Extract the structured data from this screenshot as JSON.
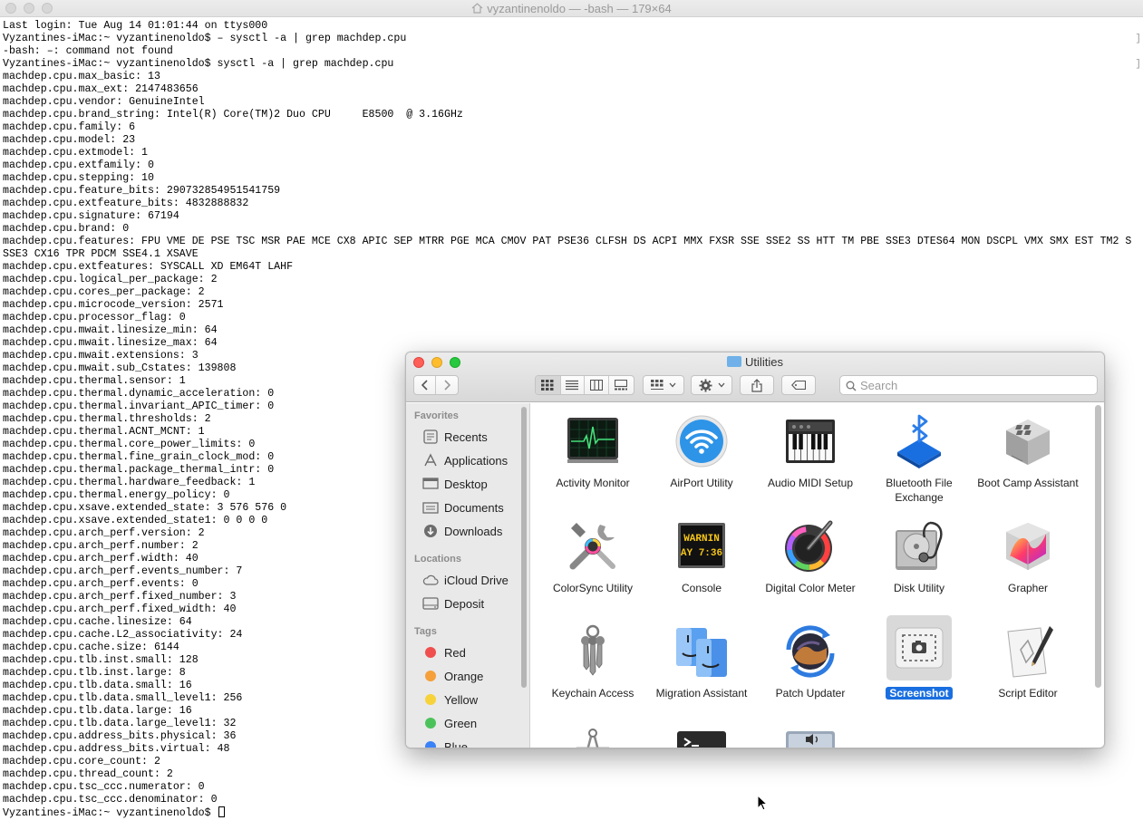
{
  "terminal": {
    "title": "vyzantinenoldo — -bash — 179×64",
    "lines": [
      "Last login: Tue Aug 14 01:01:44 on ttys000",
      "Vyzantines-iMac:~ vyzantinenoldo$ – sysctl -a | grep machdep.cpu",
      "-bash: –: command not found",
      "Vyzantines-iMac:~ vyzantinenoldo$ sysctl -a | grep machdep.cpu",
      "machdep.cpu.max_basic: 13",
      "machdep.cpu.max_ext: 2147483656",
      "machdep.cpu.vendor: GenuineIntel",
      "machdep.cpu.brand_string: Intel(R) Core(TM)2 Duo CPU     E8500  @ 3.16GHz",
      "machdep.cpu.family: 6",
      "machdep.cpu.model: 23",
      "machdep.cpu.extmodel: 1",
      "machdep.cpu.extfamily: 0",
      "machdep.cpu.stepping: 10",
      "machdep.cpu.feature_bits: 290732854951541759",
      "machdep.cpu.extfeature_bits: 4832888832",
      "machdep.cpu.signature: 67194",
      "machdep.cpu.brand: 0",
      "machdep.cpu.features: FPU VME DE PSE TSC MSR PAE MCE CX8 APIC SEP MTRR PGE MCA CMOV PAT PSE36 CLFSH DS ACPI MMX FXSR SSE SSE2 SS HTT TM PBE SSE3 DTES64 MON DSCPL VMX SMX EST TM2 S",
      "SSE3 CX16 TPR PDCM SSE4.1 XSAVE",
      "machdep.cpu.extfeatures: SYSCALL XD EM64T LAHF",
      "machdep.cpu.logical_per_package: 2",
      "machdep.cpu.cores_per_package: 2",
      "machdep.cpu.microcode_version: 2571",
      "machdep.cpu.processor_flag: 0",
      "machdep.cpu.mwait.linesize_min: 64",
      "machdep.cpu.mwait.linesize_max: 64",
      "machdep.cpu.mwait.extensions: 3",
      "machdep.cpu.mwait.sub_Cstates: 139808",
      "machdep.cpu.thermal.sensor: 1",
      "machdep.cpu.thermal.dynamic_acceleration: 0",
      "machdep.cpu.thermal.invariant_APIC_timer: 0",
      "machdep.cpu.thermal.thresholds: 2",
      "machdep.cpu.thermal.ACNT_MCNT: 1",
      "machdep.cpu.thermal.core_power_limits: 0",
      "machdep.cpu.thermal.fine_grain_clock_mod: 0",
      "machdep.cpu.thermal.package_thermal_intr: 0",
      "machdep.cpu.thermal.hardware_feedback: 1",
      "machdep.cpu.thermal.energy_policy: 0",
      "machdep.cpu.xsave.extended_state: 3 576 576 0",
      "machdep.cpu.xsave.extended_state1: 0 0 0 0",
      "machdep.cpu.arch_perf.version: 2",
      "machdep.cpu.arch_perf.number: 2",
      "machdep.cpu.arch_perf.width: 40",
      "machdep.cpu.arch_perf.events_number: 7",
      "machdep.cpu.arch_perf.events: 0",
      "machdep.cpu.arch_perf.fixed_number: 3",
      "machdep.cpu.arch_perf.fixed_width: 40",
      "machdep.cpu.cache.linesize: 64",
      "machdep.cpu.cache.L2_associativity: 24",
      "machdep.cpu.cache.size: 6144",
      "machdep.cpu.tlb.inst.small: 128",
      "machdep.cpu.tlb.inst.large: 8",
      "machdep.cpu.tlb.data.small: 16",
      "machdep.cpu.tlb.data.small_level1: 256",
      "machdep.cpu.tlb.data.large: 16",
      "machdep.cpu.tlb.data.large_level1: 32",
      "machdep.cpu.address_bits.physical: 36",
      "machdep.cpu.address_bits.virtual: 48",
      "machdep.cpu.core_count: 2",
      "machdep.cpu.thread_count: 2",
      "machdep.cpu.tsc_ccc.numerator: 0",
      "machdep.cpu.tsc_ccc.denominator: 0"
    ],
    "prompt": "Vyzantines-iMac:~ vyzantinenoldo$ "
  },
  "finder": {
    "title": "Utilities",
    "search_placeholder": "Search",
    "sidebar": {
      "favorites_heading": "Favorites",
      "favorites": [
        {
          "label": "Recents",
          "icon": "recents-icon"
        },
        {
          "label": "Applications",
          "icon": "applications-icon"
        },
        {
          "label": "Desktop",
          "icon": "desktop-icon"
        },
        {
          "label": "Documents",
          "icon": "documents-icon"
        },
        {
          "label": "Downloads",
          "icon": "downloads-icon"
        }
      ],
      "locations_heading": "Locations",
      "locations": [
        {
          "label": "iCloud Drive",
          "icon": "cloud-icon"
        },
        {
          "label": "Deposit",
          "icon": "disk-icon"
        }
      ],
      "tags_heading": "Tags",
      "tags": [
        {
          "label": "Red",
          "color": "#f04f4f"
        },
        {
          "label": "Orange",
          "color": "#f5a03a"
        },
        {
          "label": "Yellow",
          "color": "#f7d23a"
        },
        {
          "label": "Green",
          "color": "#4cc35a"
        },
        {
          "label": "Blue",
          "color": "#3a82f7"
        }
      ]
    },
    "apps": [
      {
        "label": "Activity Monitor",
        "icon": "activity-monitor-icon"
      },
      {
        "label": "AirPort Utility",
        "icon": "airport-utility-icon"
      },
      {
        "label": "Audio MIDI Setup",
        "icon": "audio-midi-icon"
      },
      {
        "label": "Bluetooth File Exchange",
        "icon": "bluetooth-icon"
      },
      {
        "label": "Boot Camp Assistant",
        "icon": "boot-camp-icon"
      },
      {
        "label": "ColorSync Utility",
        "icon": "colorsync-icon"
      },
      {
        "label": "Console",
        "icon": "console-icon"
      },
      {
        "label": "Digital Color Meter",
        "icon": "color-meter-icon"
      },
      {
        "label": "Disk Utility",
        "icon": "disk-utility-icon"
      },
      {
        "label": "Grapher",
        "icon": "grapher-icon"
      },
      {
        "label": "Keychain Access",
        "icon": "keychain-icon"
      },
      {
        "label": "Migration Assistant",
        "icon": "migration-icon"
      },
      {
        "label": "Patch Updater",
        "icon": "patch-updater-icon"
      },
      {
        "label": "Screenshot",
        "icon": "screenshot-icon"
      },
      {
        "label": "Script Editor",
        "icon": "script-editor-icon"
      }
    ],
    "console_icon_text": {
      "line1": "WARNIN",
      "line2": "AY 7:36"
    },
    "selected_app": "Screenshot"
  }
}
